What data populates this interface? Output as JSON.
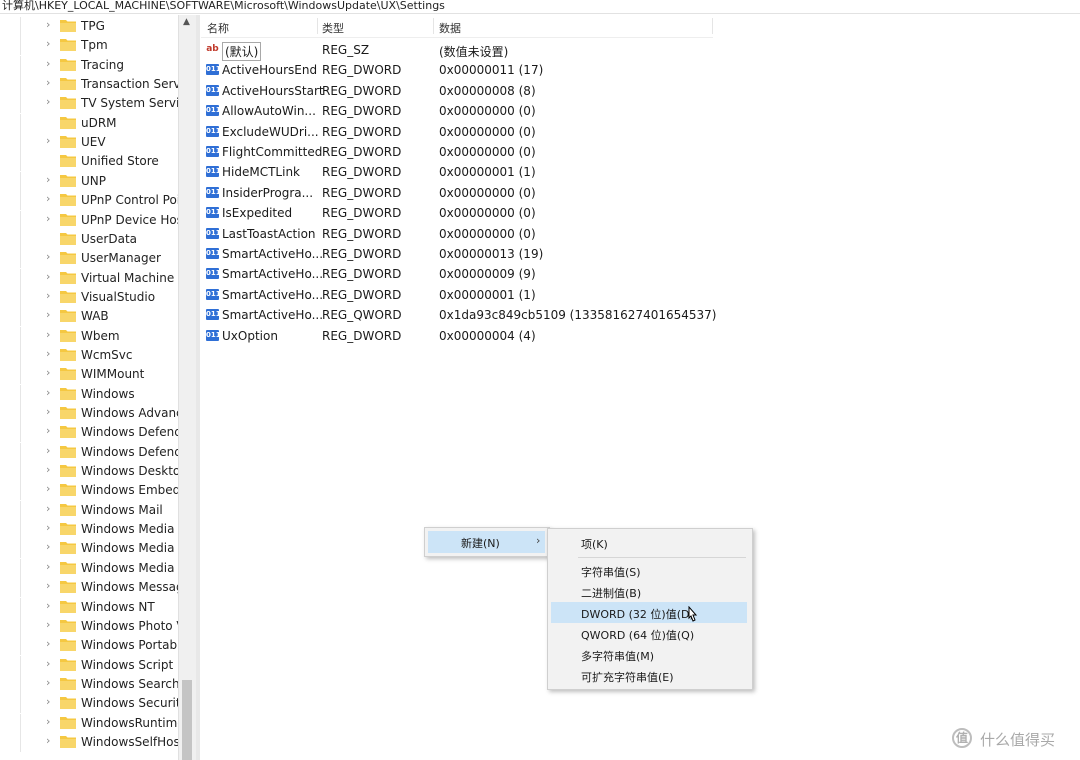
{
  "address_bar": "计算机\\HKEY_LOCAL_MACHINE\\SOFTWARE\\Microsoft\\WindowsUpdate\\UX\\Settings",
  "tree": {
    "items": [
      {
        "label": "TPG",
        "expandable": true
      },
      {
        "label": "Tpm",
        "expandable": true
      },
      {
        "label": "Tracing",
        "expandable": true
      },
      {
        "label": "Transaction Servi",
        "expandable": true
      },
      {
        "label": "TV System Servic",
        "expandable": true
      },
      {
        "label": "uDRM",
        "expandable": false
      },
      {
        "label": "UEV",
        "expandable": true
      },
      {
        "label": "Unified Store",
        "expandable": false
      },
      {
        "label": "UNP",
        "expandable": true
      },
      {
        "label": "UPnP Control Poi",
        "expandable": true
      },
      {
        "label": "UPnP Device Hos",
        "expandable": true
      },
      {
        "label": "UserData",
        "expandable": false
      },
      {
        "label": "UserManager",
        "expandable": true
      },
      {
        "label": "Virtual Machine",
        "expandable": true
      },
      {
        "label": "VisualStudio",
        "expandable": true
      },
      {
        "label": "WAB",
        "expandable": true
      },
      {
        "label": "Wbem",
        "expandable": true
      },
      {
        "label": "WcmSvc",
        "expandable": true
      },
      {
        "label": "WIMMount",
        "expandable": true
      },
      {
        "label": "Windows",
        "expandable": true
      },
      {
        "label": "Windows Advanc",
        "expandable": true
      },
      {
        "label": "Windows Defend",
        "expandable": true
      },
      {
        "label": "Windows Defend",
        "expandable": true
      },
      {
        "label": "Windows Deskto",
        "expandable": true
      },
      {
        "label": "Windows Embed",
        "expandable": true
      },
      {
        "label": "Windows Mail",
        "expandable": true
      },
      {
        "label": "Windows Media",
        "expandable": true
      },
      {
        "label": "Windows Media",
        "expandable": true
      },
      {
        "label": "Windows Media",
        "expandable": true
      },
      {
        "label": "Windows Messag",
        "expandable": true
      },
      {
        "label": "Windows NT",
        "expandable": true
      },
      {
        "label": "Windows Photo V",
        "expandable": true
      },
      {
        "label": "Windows Portabl",
        "expandable": true
      },
      {
        "label": "Windows Script H",
        "expandable": true
      },
      {
        "label": "Windows Search",
        "expandable": true
      },
      {
        "label": "Windows Security",
        "expandable": true
      },
      {
        "label": "WindowsRuntime",
        "expandable": true
      },
      {
        "label": "WindowsSelfHost",
        "expandable": true
      }
    ]
  },
  "values_panel": {
    "headers": {
      "name": "名称",
      "type": "类型",
      "data": "数据"
    },
    "rows": [
      {
        "icon": "string",
        "name": "(默认)",
        "type": "REG_SZ",
        "data": "(数值未设置)"
      },
      {
        "icon": "binary",
        "name": "ActiveHoursEnd",
        "type": "REG_DWORD",
        "data": "0x00000011 (17)"
      },
      {
        "icon": "binary",
        "name": "ActiveHoursStart",
        "type": "REG_DWORD",
        "data": "0x00000008 (8)"
      },
      {
        "icon": "binary",
        "name": "AllowAutoWin...",
        "type": "REG_DWORD",
        "data": "0x00000000 (0)"
      },
      {
        "icon": "binary",
        "name": "ExcludeWUDri...",
        "type": "REG_DWORD",
        "data": "0x00000000 (0)"
      },
      {
        "icon": "binary",
        "name": "FlightCommitted",
        "type": "REG_DWORD",
        "data": "0x00000000 (0)"
      },
      {
        "icon": "binary",
        "name": "HideMCTLink",
        "type": "REG_DWORD",
        "data": "0x00000001 (1)"
      },
      {
        "icon": "binary",
        "name": "InsiderProgra...",
        "type": "REG_DWORD",
        "data": "0x00000000 (0)"
      },
      {
        "icon": "binary",
        "name": "IsExpedited",
        "type": "REG_DWORD",
        "data": "0x00000000 (0)"
      },
      {
        "icon": "binary",
        "name": "LastToastAction",
        "type": "REG_DWORD",
        "data": "0x00000000 (0)"
      },
      {
        "icon": "binary",
        "name": "SmartActiveHo...",
        "type": "REG_DWORD",
        "data": "0x00000013 (19)"
      },
      {
        "icon": "binary",
        "name": "SmartActiveHo...",
        "type": "REG_DWORD",
        "data": "0x00000009 (9)"
      },
      {
        "icon": "binary",
        "name": "SmartActiveHo...",
        "type": "REG_DWORD",
        "data": "0x00000001 (1)"
      },
      {
        "icon": "binary",
        "name": "SmartActiveHo...",
        "type": "REG_QWORD",
        "data": "0x1da93c849cb5109 (133581627401654537)"
      },
      {
        "icon": "binary",
        "name": "UxOption",
        "type": "REG_DWORD",
        "data": "0x00000004 (4)"
      }
    ]
  },
  "context_menu": {
    "new_label": "新建(N)",
    "arrow": "›"
  },
  "submenu": {
    "items": [
      {
        "label": "项(K)",
        "highlighted": false
      },
      {
        "label": "字符串值(S)",
        "highlighted": false
      },
      {
        "label": "二进制值(B)",
        "highlighted": false
      },
      {
        "label": "DWORD (32 位)值(D)",
        "highlighted": true
      },
      {
        "label": "QWORD (64 位)值(Q)",
        "highlighted": false
      },
      {
        "label": "多字符串值(M)",
        "highlighted": false
      },
      {
        "label": "可扩充字符串值(E)",
        "highlighted": false
      }
    ]
  },
  "watermark": {
    "logo": "值",
    "text": "什么值得买"
  },
  "icons": {
    "string_icon": "ab",
    "binary_icon": "011",
    "scroll_up": "▲",
    "chevron": "›"
  },
  "colors": {
    "selection": "#cce4f7",
    "folder": "#f5c842",
    "binary_icon": "#2f6fd6"
  }
}
